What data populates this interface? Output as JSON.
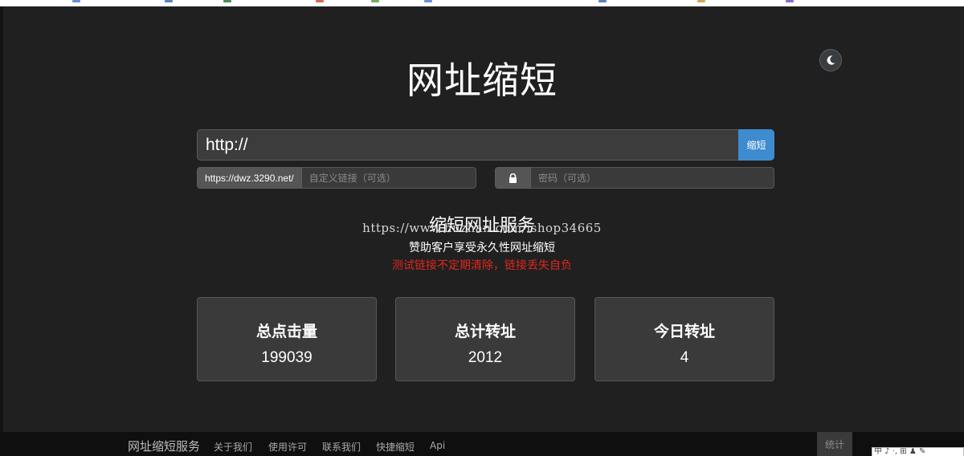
{
  "header": {
    "title": "网址缩短",
    "theme_toggle_icon": "moon-icon"
  },
  "form": {
    "url_value": "http://",
    "shorten_label": "缩短",
    "prefix_text": "https://dwz.3290.net/",
    "custom_link_placeholder": "自定义链接（可选）",
    "password_placeholder": "密码（可选）",
    "lock_icon": "lock-icon"
  },
  "intro": {
    "subtitle": "缩短网址服务",
    "watermark": "https://www.huzhan.com/ishop34665",
    "tagline": "赞助客户享受永久性网址缩短",
    "notice": "测试链接不定期清除，链接丢失自负",
    "notice_color": "#e0261d"
  },
  "stats": [
    {
      "label": "总点击量",
      "value": "199039"
    },
    {
      "label": "总计转址",
      "value": "2012"
    },
    {
      "label": "今日转址",
      "value": "4"
    }
  ],
  "footer": {
    "brand": "网址缩短服务",
    "links": [
      "关于我们",
      "使用许可",
      "联系我们",
      "快捷缩短",
      "Api"
    ],
    "stats_label": "统计"
  },
  "ime_bar": "中 ♪ ·, ⊞ ♟ ✎",
  "colors": {
    "background": "#202020",
    "accent": "#3f8bd0",
    "card": "#3a3a3a"
  }
}
